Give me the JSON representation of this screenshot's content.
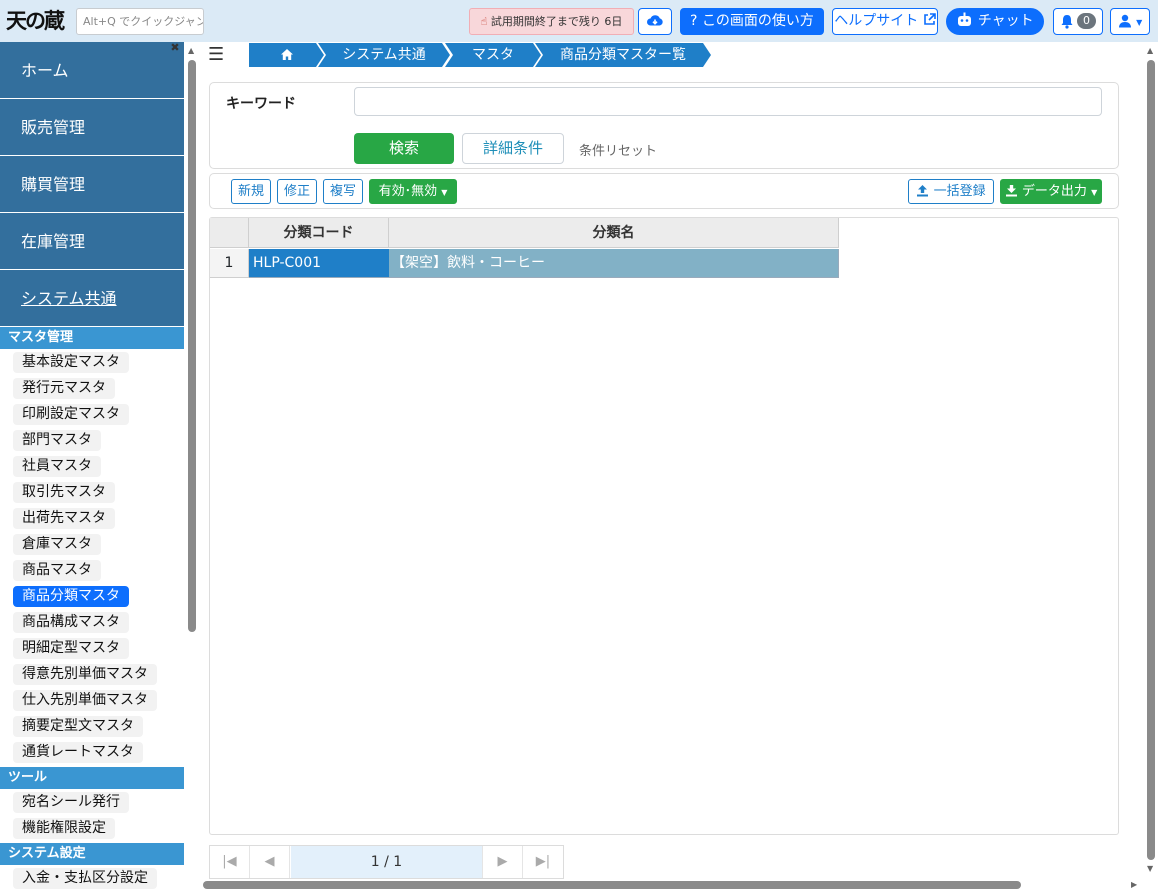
{
  "header": {
    "logo_text": "天の蔵",
    "quick_jump_placeholder": "Alt+Q でクイックジャンプ",
    "trial_notice": "試用期間終了まで残り 6日",
    "help_screen_label": "この画面の使い方",
    "help_site_label": "ヘルプサイト",
    "chat_label": "チャット",
    "notification_count": "0"
  },
  "sidebar": {
    "main_items": [
      {
        "label": "ホーム"
      },
      {
        "label": "販売管理"
      },
      {
        "label": "購買管理"
      },
      {
        "label": "在庫管理"
      },
      {
        "label": "システム共通"
      }
    ],
    "sections": [
      {
        "title": "マスタ管理",
        "items": [
          "基本設定マスタ",
          "発行元マスタ",
          "印刷設定マスタ",
          "部門マスタ",
          "社員マスタ",
          "取引先マスタ",
          "出荷先マスタ",
          "倉庫マスタ",
          "商品マスタ",
          "商品分類マスタ",
          "商品構成マスタ",
          "明細定型マスタ",
          "得意先別単価マスタ",
          "仕入先別単価マスタ",
          "摘要定型文マスタ",
          "通貨レートマスタ"
        ]
      },
      {
        "title": "ツール",
        "items": [
          "宛名シール発行",
          "機能権限設定"
        ]
      },
      {
        "title": "システム設定",
        "items": [
          "入金・支払区分設定"
        ]
      }
    ],
    "active_item": "商品分類マスタ"
  },
  "breadcrumb": {
    "home_icon": "home-icon",
    "items": [
      "システム共通",
      "マスタ",
      "商品分類マスター覧"
    ]
  },
  "search": {
    "keyword_label": "キーワード",
    "keyword_value": "",
    "search_button": "検索",
    "detail_button": "詳細条件",
    "reset_link": "条件リセット"
  },
  "toolbar": {
    "new_label": "新規",
    "edit_label": "修正",
    "copy_label": "複写",
    "valid_label": "有効･無効",
    "bulk_register_label": "一括登録",
    "export_label": "データ出力"
  },
  "grid": {
    "headers": [
      "分類コード",
      "分類名"
    ],
    "rows": [
      {
        "no": "1",
        "code": "HLP-C001",
        "name": "【架空】飲料・コーヒー"
      }
    ]
  },
  "pager": {
    "page_info": "1 / 1"
  },
  "colors": {
    "topbar_bg": "#dbeaf6",
    "nav_bg": "#336f9d",
    "section_bg": "#3a96d2",
    "primary": "#0d6efd",
    "success": "#28a745",
    "breadcrumb_bg": "#1f7fc8",
    "selected_code_bg": "#1f7fc8",
    "selected_name_bg": "#82b1c6"
  }
}
